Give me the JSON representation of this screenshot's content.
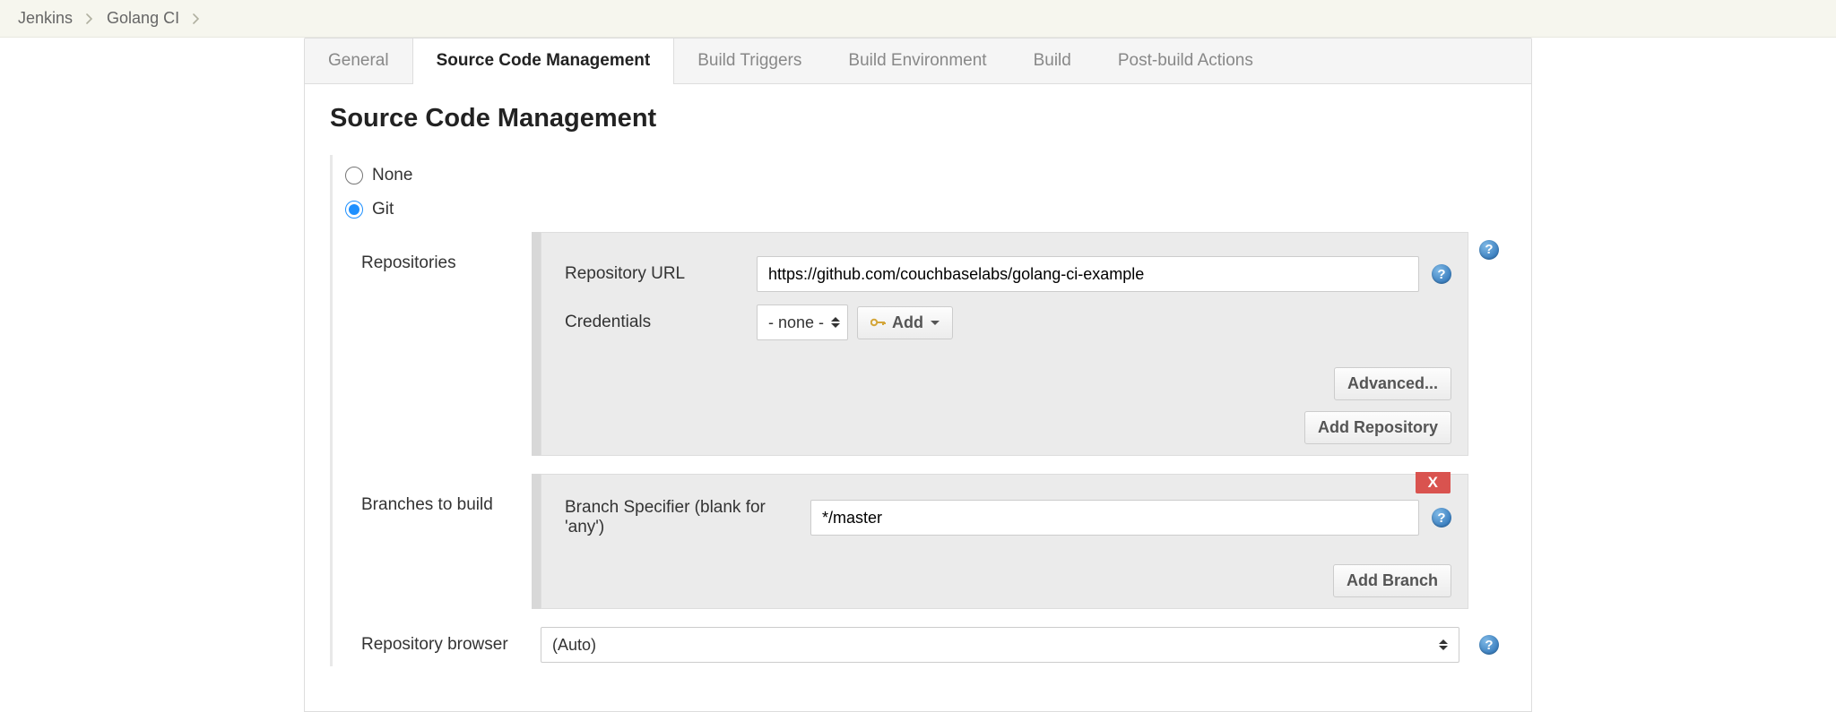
{
  "breadcrumbs": [
    "Jenkins",
    "Golang CI"
  ],
  "tabs": [
    "General",
    "Source Code Management",
    "Build Triggers",
    "Build Environment",
    "Build",
    "Post-build Actions"
  ],
  "active_tab_index": 1,
  "section_title": "Source Code Management",
  "scm": {
    "options": [
      {
        "label": "None",
        "selected": false
      },
      {
        "label": "Git",
        "selected": true
      }
    ],
    "repositories_label": "Repositories",
    "branches_label": "Branches to build",
    "browser_label": "Repository browser",
    "repo_url_label": "Repository URL",
    "repo_url_value": "https://github.com/couchbaselabs/golang-ci-example",
    "credentials_label": "Credentials",
    "credentials_selected": "- none -",
    "add_button": "Add",
    "advanced_button": "Advanced...",
    "add_repository_button": "Add Repository",
    "branch_specifier_label": "Branch Specifier (blank for 'any')",
    "branch_specifier_value": "*/master",
    "add_branch_button": "Add Branch",
    "delete_label": "X",
    "browser_value": "(Auto)"
  }
}
